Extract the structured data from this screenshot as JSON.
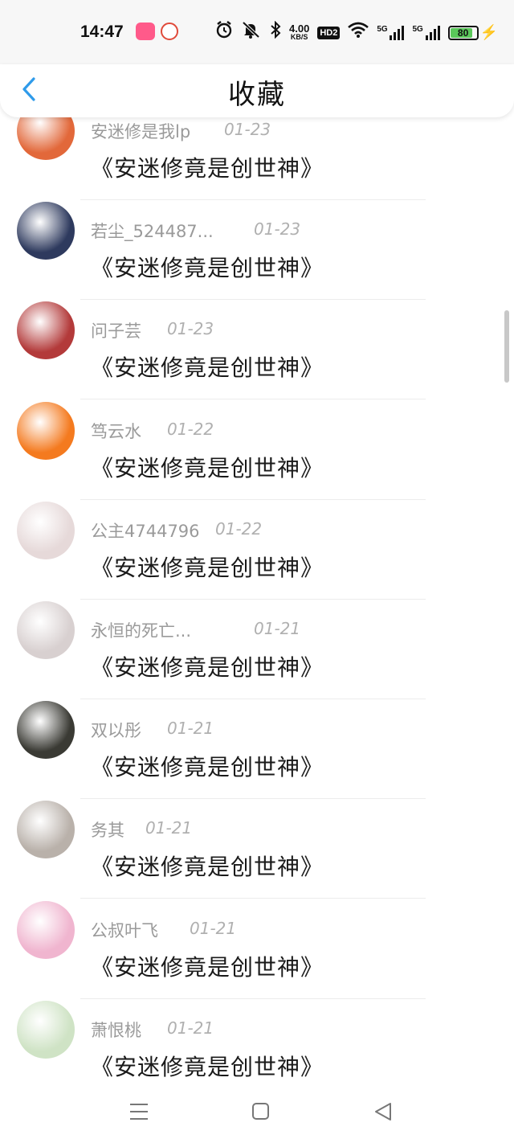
{
  "status_bar": {
    "time": "14:47",
    "net_speed_value": "4.00",
    "net_speed_unit": "KB/S",
    "hd_label": "HD2",
    "signal1_label": "5G",
    "signal2_label": "5G",
    "battery": "80",
    "icons": [
      "bilibili-app-icon",
      "app2-icon",
      "alarm-icon",
      "mute-icon",
      "bluetooth-icon",
      "wifi-icon",
      "charging-icon"
    ]
  },
  "header": {
    "title": "收藏",
    "back_icon": "chevron-left-icon"
  },
  "items": [
    {
      "name": "安迷修是我lp",
      "date": "01-23",
      "book": "《安迷修竟是创世神》",
      "avatar_color": "#e2683a"
    },
    {
      "name": "若尘_524487...",
      "date": "01-23",
      "book": "《安迷修竟是创世神》",
      "avatar_color": "#2e3a5e"
    },
    {
      "name": "问子芸",
      "date": "01-23",
      "book": "《安迷修竟是创世神》",
      "avatar_color": "#b33a3a"
    },
    {
      "name": "笃云水",
      "date": "01-22",
      "book": "《安迷修竟是创世神》",
      "avatar_color": "#f47a1f"
    },
    {
      "name": "公主4744796",
      "date": "01-22",
      "book": "《安迷修竟是创世神》",
      "avatar_color": "#e6d9d9"
    },
    {
      "name": "永恒的死亡...",
      "date": "01-21",
      "book": "《安迷修竟是创世神》",
      "avatar_color": "#d8d0d0"
    },
    {
      "name": "双以彤",
      "date": "01-21",
      "book": "《安迷修竟是创世神》",
      "avatar_color": "#3a3a34"
    },
    {
      "name": "务其",
      "date": "01-21",
      "book": "《安迷修竟是创世神》",
      "avatar_color": "#b9b1aa"
    },
    {
      "name": "公叔叶飞",
      "date": "01-21",
      "book": "《安迷修竟是创世神》",
      "avatar_color": "#f0b5cf"
    },
    {
      "name": "萧恨桃",
      "date": "01-21",
      "book": "《安迷修竟是创世神》",
      "avatar_color": "#cfe3c5"
    }
  ],
  "nav": {
    "menu_icon": "menu-icon",
    "home_icon": "home-square-icon",
    "back_icon": "back-triangle-icon"
  },
  "colors": {
    "accent": "#2f9bea",
    "name_gray": "#9a9a9a",
    "date_gray": "#b0b0b0"
  }
}
